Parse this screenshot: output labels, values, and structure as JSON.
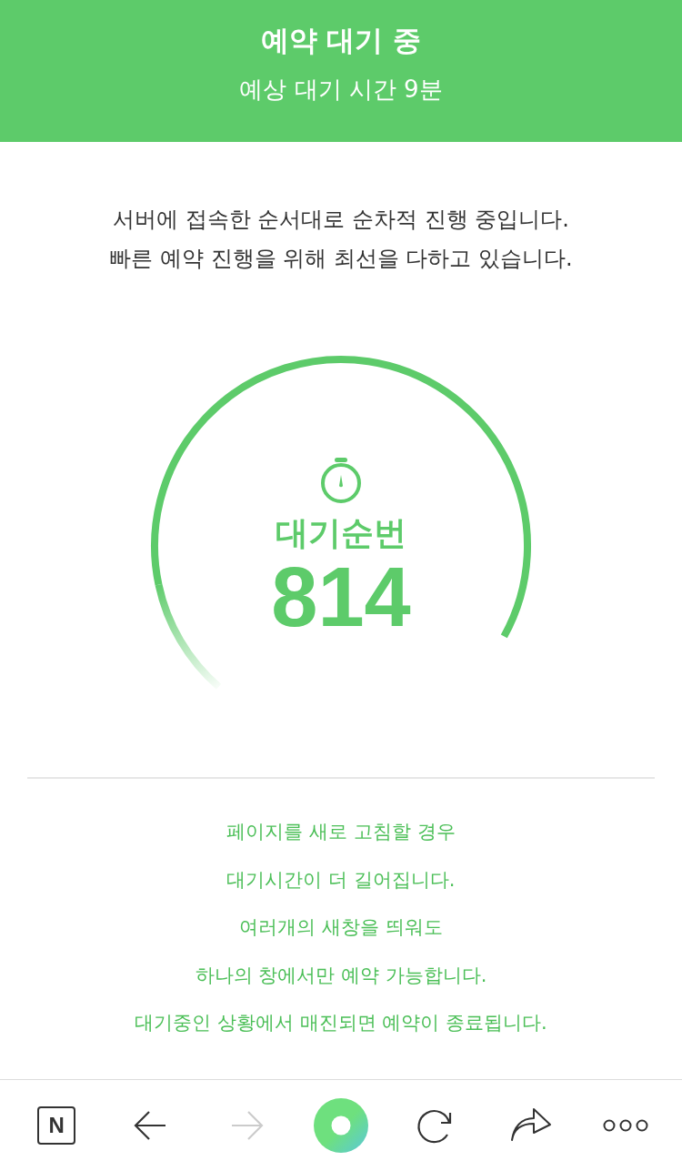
{
  "header": {
    "title": "예약 대기 중",
    "subtitle": "예상 대기 시간 9분"
  },
  "message": [
    "서버에 접속한 순서대로 순차적 진행 중입니다.",
    "빠른 예약 진행을 위해 최선을 다하고 있습니다."
  ],
  "queue": {
    "label": "대기순번",
    "number": "814"
  },
  "notes": [
    "페이지를 새로 고침할 경우",
    "대기시간이 더 길어집니다.",
    "여러개의 새창을 띄워도",
    "하나의 창에서만 예약 가능합니다.",
    "대기중인 상황에서 매진되면 예약이 종료됩니다."
  ],
  "toolbar": [
    {
      "kind": "home",
      "label": "N",
      "disabled": false
    },
    {
      "kind": "back",
      "disabled": false
    },
    {
      "kind": "forward",
      "disabled": true
    },
    {
      "kind": "center",
      "disabled": false
    },
    {
      "kind": "reload",
      "disabled": false
    },
    {
      "kind": "share",
      "disabled": false
    },
    {
      "kind": "more",
      "disabled": false
    }
  ]
}
